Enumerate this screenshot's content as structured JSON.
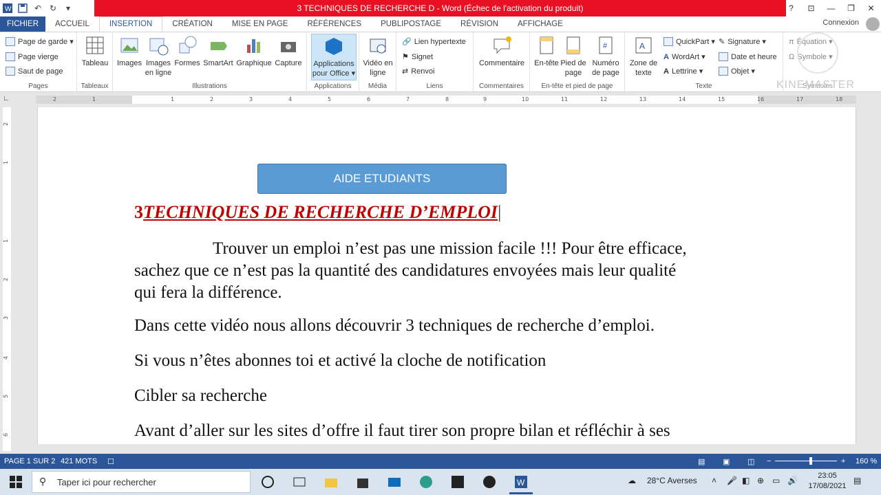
{
  "window": {
    "title": "3 TECHNIQUES DE RECHERCHE D  -  Word (Échec de l'activation du produit)",
    "controls": [
      "?",
      "⊡",
      "—",
      "❐",
      "✕"
    ]
  },
  "tabs": [
    {
      "label": "FICHIER"
    },
    {
      "label": "ACCUEIL"
    },
    {
      "label": "INSERTION"
    },
    {
      "label": "CRÉATION"
    },
    {
      "label": "MISE EN PAGE"
    },
    {
      "label": "RÉFÉRENCES"
    },
    {
      "label": "PUBLIPOSTAGE"
    },
    {
      "label": "RÉVISION"
    },
    {
      "label": "AFFICHAGE"
    }
  ],
  "signin": "Connexion",
  "ribbon": {
    "pages": {
      "label": "Pages",
      "items": [
        "Page de garde ▾",
        "Page vierge",
        "Saut de page"
      ]
    },
    "tables": {
      "label": "Tableaux",
      "items": [
        "Tableau"
      ]
    },
    "illustrations": {
      "label": "Illustrations",
      "items": [
        "Images",
        "Images en ligne",
        "Formes",
        "SmartArt",
        "Graphique",
        "Capture"
      ]
    },
    "apps": {
      "label": "Applications",
      "items": [
        "Applications pour Office ▾"
      ]
    },
    "media": {
      "label": "Média",
      "items": [
        "Vidéo en ligne"
      ]
    },
    "links": {
      "label": "Liens",
      "items": [
        "Lien hypertexte",
        "Signet",
        "Renvoi"
      ]
    },
    "comments": {
      "label": "Commentaires",
      "items": [
        "Commentaire"
      ]
    },
    "headerfooter": {
      "label": "En-tête et pied de page",
      "items": [
        "En-tête",
        "Pied de page",
        "Numéro de page"
      ]
    },
    "text": {
      "label": "Texte",
      "items": [
        "Zone de texte",
        "QuickPart ▾",
        "WordArt ▾",
        "Lettrine ▾",
        "Signature ▾",
        "Date et heure",
        "Objet ▾"
      ]
    },
    "symbols": {
      "label": "Symboles",
      "items": [
        "Équation ▾",
        "Symbole ▾"
      ]
    }
  },
  "ruler_ticks": [
    "2",
    "1",
    "1",
    "2",
    "3",
    "4",
    "5",
    "6",
    "7",
    "8",
    "9",
    "10",
    "11",
    "12",
    "13",
    "14",
    "15",
    "16",
    "17",
    "18"
  ],
  "vruler_ticks": [
    "2",
    "1",
    "1",
    "2",
    "3",
    "4",
    "5",
    "6"
  ],
  "document": {
    "banner": "AIDE ETUDIANTS",
    "heading_num": "3",
    "heading_text": "TECHNIQUES DE RECHERCHE D’EMPLOI",
    "p1_line1": "Trouver un emploi n’est pas une mission facile !!! Pour être efficace,",
    "p1_line2": "sachez que ce n’est pas la quantité des candidatures envoyées mais leur qualité",
    "p1_line3": "qui fera la différence.",
    "p2": "Dans cette vidéo nous allons découvrir 3 techniques de recherche d’emploi.",
    "p3": "Si vous n’êtes abonnes toi et activé la cloche de notification",
    "p4": "Cibler sa recherche",
    "p5": "Avant d’aller sur les sites d’offre il faut tirer son propre bilan et réfléchir à ses"
  },
  "statusbar": {
    "page": "PAGE 1 SUR 2",
    "words": "421 MOTS",
    "zoom": "160 %"
  },
  "watermark": "KINEMASTER",
  "taskbar": {
    "search_placeholder": "Taper ici pour rechercher",
    "weather": "28°C  Averses",
    "time": "23:05",
    "date": "17/08/2021"
  }
}
